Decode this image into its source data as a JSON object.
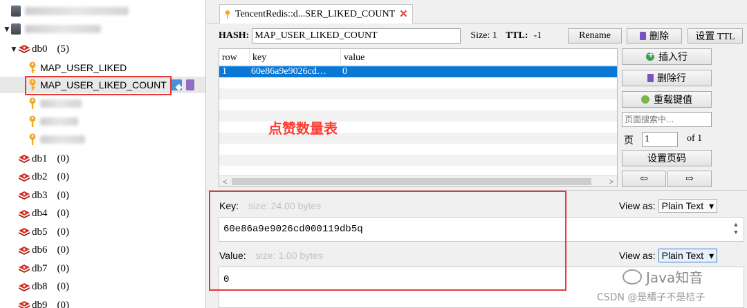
{
  "tree": {
    "db0": {
      "label": "db0",
      "count": "(5)"
    },
    "keys": [
      "MAP_USER_LIKED",
      "MAP_USER_LIKED_COUNT"
    ],
    "dbs": [
      {
        "label": "db1",
        "count": "(0)"
      },
      {
        "label": "db2",
        "count": "(0)"
      },
      {
        "label": "db3",
        "count": "(0)"
      },
      {
        "label": "db4",
        "count": "(0)"
      },
      {
        "label": "db5",
        "count": "(0)"
      },
      {
        "label": "db6",
        "count": "(0)"
      },
      {
        "label": "db7",
        "count": "(0)"
      },
      {
        "label": "db8",
        "count": "(0)"
      },
      {
        "label": "db9",
        "count": "(0)"
      }
    ]
  },
  "tab": {
    "title": "TencentRedis::d...SER_LIKED_COUNT",
    "close": "✕"
  },
  "hashbar": {
    "type_label": "HASH:",
    "key_name": "MAP_USER_LIKED_COUNT",
    "size": "Size: 1",
    "ttl_label": "TTL:",
    "ttl_value": "-1",
    "rename": "Rename",
    "delete": "删除",
    "set_ttl": "设置 TTL"
  },
  "grid": {
    "columns": [
      "row",
      "key",
      "value"
    ],
    "rows": [
      {
        "row": "1",
        "key": "60e86a9e9026cd…",
        "value": "0"
      }
    ]
  },
  "side_buttons": {
    "insert_row": "插入行",
    "delete_row": "删除行",
    "reload": "重载键值",
    "search_placeholder": "页面搜索中...",
    "page_label": "页",
    "page_value": "1",
    "page_of": "of 1",
    "set_page": "设置页码",
    "prev": "⇦",
    "next": "⇨"
  },
  "annotation": "点赞数量表",
  "key_panel": {
    "label": "Key:",
    "hint": "size: 24.00 bytes",
    "view_as": "View as:",
    "format": "Plain Text",
    "value": "60e86a9e9026cd000119db5q"
  },
  "value_panel": {
    "label": "Value:",
    "hint": "size: 1.00 bytes",
    "view_as": "View as:",
    "format": "Plain Text",
    "value": "0"
  },
  "watermark": "Java知音",
  "credit": "CSDN @是橘子不是桔子",
  "colors": {
    "selection": "#0a78d7",
    "highlight": "#e53935",
    "annotation": "#ff3b30"
  }
}
